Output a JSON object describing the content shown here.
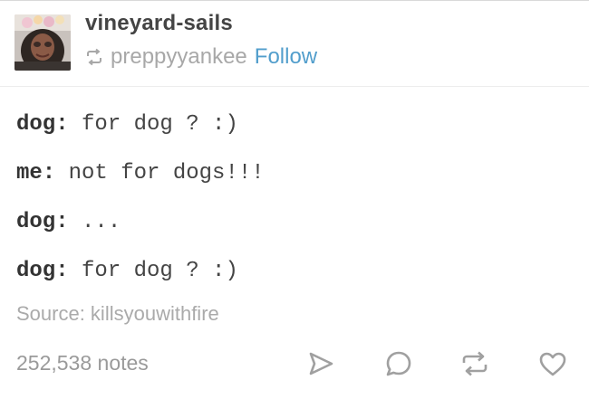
{
  "post": {
    "blog_name": "vineyard-sails",
    "reblogged_from": "preppyyankee",
    "follow_label": "Follow",
    "chat": [
      {
        "speaker": "dog:",
        "text": " for dog ? :)"
      },
      {
        "speaker": "me:",
        "text": " not for dogs!!!"
      },
      {
        "speaker": "dog:",
        "text": " ..."
      },
      {
        "speaker": "dog:",
        "text": " for dog ? :)"
      }
    ],
    "source_label": "Source: killsyouwithfire",
    "notes": "252,538 notes"
  },
  "icons": {
    "reblog_small": "reblog-icon",
    "share": "share-icon",
    "reply": "reply-icon",
    "reblog": "reblog-icon",
    "like": "heart-icon"
  },
  "colors": {
    "accent": "#529ecc",
    "muted": "#a8a8a8",
    "text": "#444444"
  }
}
